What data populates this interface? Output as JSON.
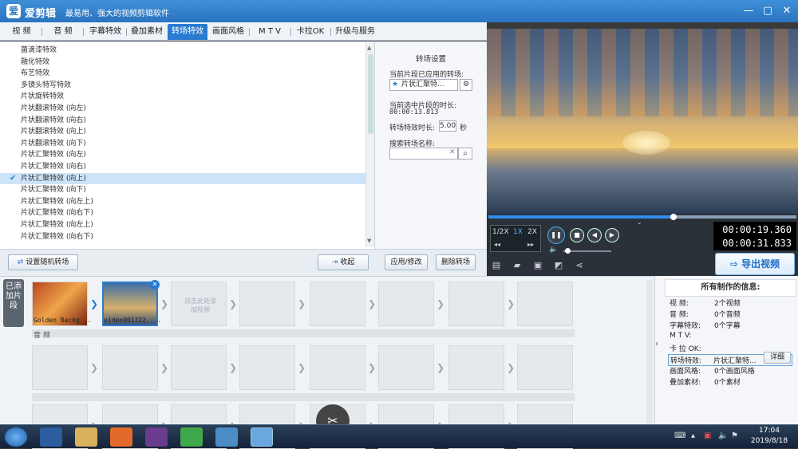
{
  "titlebar": {
    "logo": "爱",
    "app_name": "爱剪辑",
    "slogan": "最易用、强大的视频剪辑软件",
    "min": "—",
    "max": "▢",
    "close": "✕"
  },
  "tabs": [
    "视 频",
    "音 频",
    "字幕特效",
    "叠加素材",
    "转场特效",
    "画面风格",
    "M T V",
    "卡拉OK",
    "升级与服务"
  ],
  "effects": [
    "菌滴漆特效",
    "融化特效",
    "布艺特效",
    "多镜头特写特效",
    "片状旋转特效",
    "片状翻滚特效 (向左)",
    "片状翻滚特效 (向右)",
    "片状翻滚特效 (向上)",
    "片状翻滚特效 (向下)",
    "片状汇聚特效 (向左)",
    "片状汇聚特效 (向右)",
    "片状汇聚特效 (向上)",
    "片状汇聚特效 (向下)",
    "片状汇聚特效 (向左上)",
    "片状汇聚特效 (向右下)",
    "片状汇聚特效 (向左上)",
    "片状汇聚特效 (向右下)"
  ],
  "selected_effect_index": 11,
  "settings": {
    "title": "转场设置",
    "applied_label": "当前片段已应用的转场:",
    "applied_value": "片状汇聚特...",
    "duration_label": "当前选中片段的时长:",
    "duration_value": "00:00:13.813",
    "effect_duration_label": "转场特效时长:",
    "effect_duration_value": "5.00",
    "effect_duration_unit": "秒",
    "search_label": "搜索转场名称:",
    "search_value": ""
  },
  "buttons": {
    "random": "设置随机转场",
    "collapse": "收起",
    "apply": "应用/修改",
    "delete": "删除转场",
    "export": "导出视频"
  },
  "player": {
    "progress": 0.6,
    "speeds": [
      "1/2X",
      "1X",
      "2X"
    ],
    "time_current": "00:00:19.360",
    "time_total": "00:00:31.833"
  },
  "timeline": {
    "label": "已添加片段",
    "clips": [
      {
        "name": "Golden Backg..."
      },
      {
        "name": "video901722...."
      }
    ],
    "placeholder": "双击此处添加视频",
    "audio_label": "音 频"
  },
  "info": {
    "title": "所有制作的信息:",
    "rows": [
      {
        "k": "视    频:",
        "v": "2个视频"
      },
      {
        "k": "音    频:",
        "v": "0个音频"
      },
      {
        "k": "字幕特效:",
        "v": "0个字幕"
      },
      {
        "k": "M  T  V:",
        "v": ""
      },
      {
        "k": "卡 拉 OK:",
        "v": ""
      },
      {
        "k": "转场特效:",
        "v": "片状汇聚特..."
      },
      {
        "k": "画面风格:",
        "v": "0个画面风格"
      },
      {
        "k": "叠加素材:",
        "v": "0个素材"
      }
    ],
    "detail_button": "详细"
  },
  "taskbar": {
    "time": "17:04",
    "date": "2019/8/18"
  },
  "colors": {
    "accent": "#2a7bd0",
    "titlebar": "#2a74c0"
  }
}
